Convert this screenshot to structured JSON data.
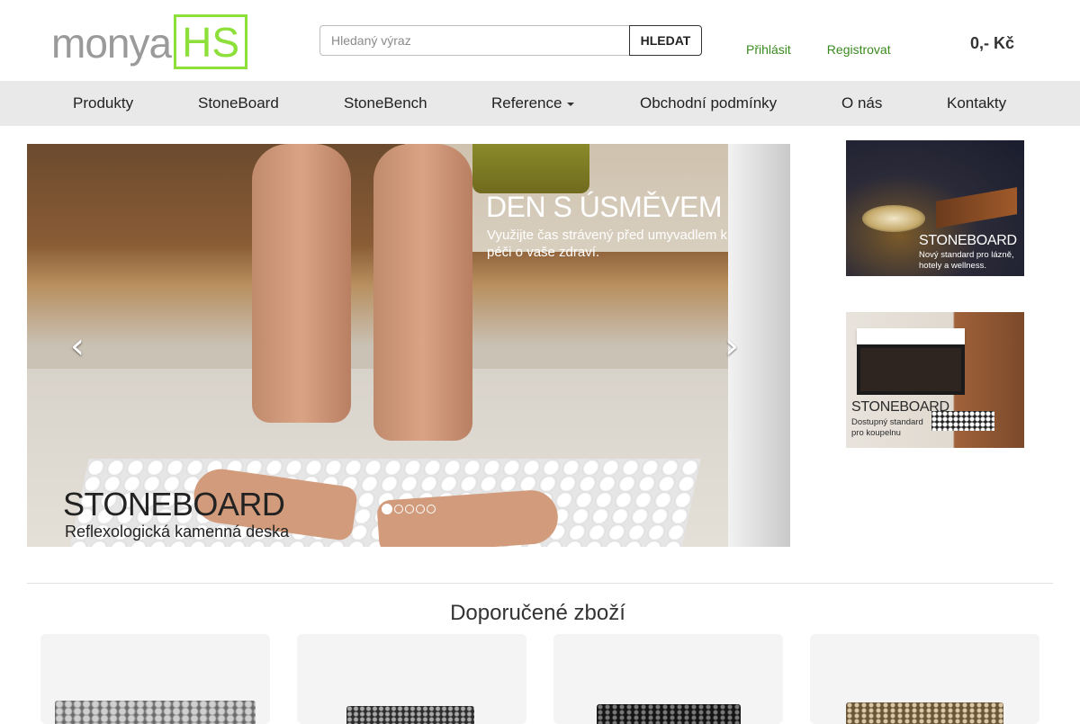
{
  "brand": {
    "logo_text": "monya",
    "logo_box_text": "HS",
    "accent_color": "#8ddf3a",
    "link_color": "#3a8a1f"
  },
  "search": {
    "placeholder": "Hledaný výraz",
    "value": "",
    "button_label": "HLEDAT"
  },
  "account": {
    "login_label": "Přihlásit",
    "register_label": "Registrovat"
  },
  "cart": {
    "total": "0,- Kč"
  },
  "nav": {
    "items": [
      {
        "label": "Produkty"
      },
      {
        "label": "StoneBoard"
      },
      {
        "label": "StoneBench"
      },
      {
        "label": "Reference",
        "has_dropdown": true
      },
      {
        "label": "Obchodní podmínky"
      },
      {
        "label": "O nás"
      },
      {
        "label": "Kontakty"
      }
    ]
  },
  "carousel": {
    "headline": "DEN S ÚSMĚVEM",
    "subtext": "Využijte čas strávený před umyvadlem k péči o vaše zdraví.",
    "brand_text": "STONEBOARD",
    "brand_subtext": "Reflexologická kamenná deska",
    "prev_icon": "chevron-left-icon",
    "next_icon": "chevron-right-icon",
    "slide_count": 5,
    "active_index": 0
  },
  "side_banners": [
    {
      "title": "STONEBOARD",
      "subtitle": "Nový standard pro lázně, hotely a wellness."
    },
    {
      "title": "STONEBOARD",
      "subtitle": "Dostupný standard pro koupelnu"
    }
  ],
  "recommended": {
    "title": "Doporučené zboží",
    "products_visible": 4
  }
}
